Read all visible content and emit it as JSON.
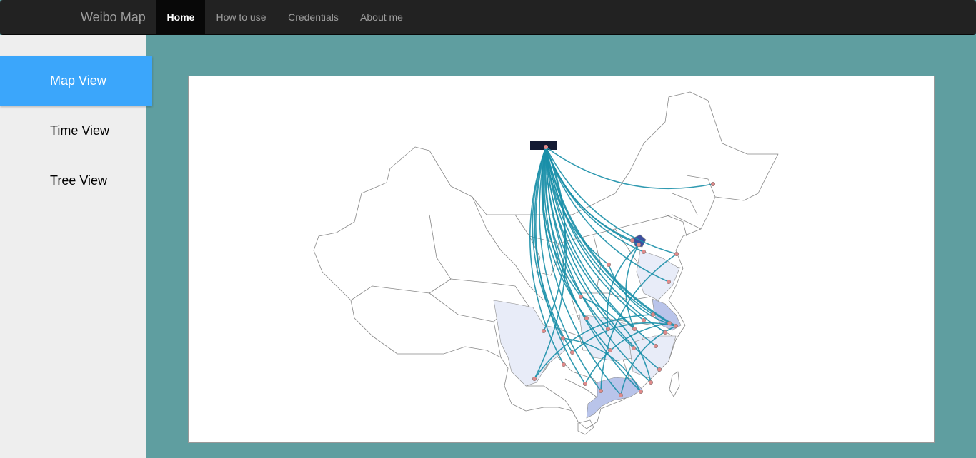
{
  "navbar": {
    "brand": "Weibo Map",
    "items": [
      {
        "label": "Home",
        "active": true
      },
      {
        "label": "How to use",
        "active": false
      },
      {
        "label": "Credentials",
        "active": false
      },
      {
        "label": "About me",
        "active": false
      }
    ]
  },
  "sidebar": {
    "items": [
      {
        "label": "Map View",
        "active": true
      },
      {
        "label": "Time View",
        "active": false
      },
      {
        "label": "Tree View",
        "active": false
      }
    ]
  },
  "map": {
    "colors": {
      "flow_line": "#1a8fa8",
      "node": "#e08a8a",
      "origin": "#131a33",
      "region_light": "#e8ecf8",
      "region_medium": "#b9c4ea",
      "region_dark": "#3d4fa0",
      "border": "#888888"
    }
  }
}
